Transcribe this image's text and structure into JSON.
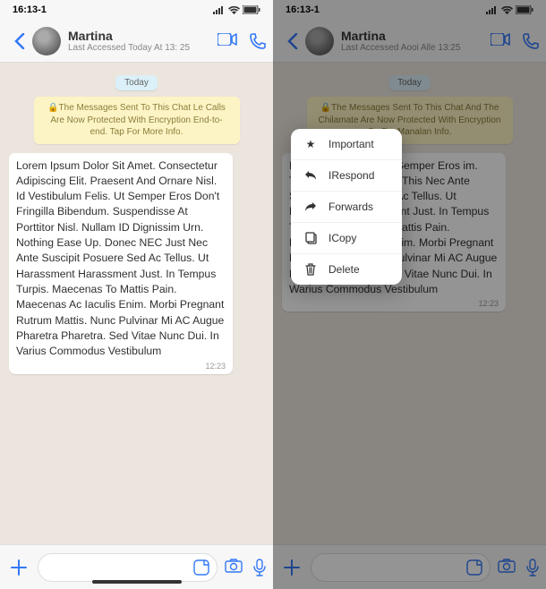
{
  "status": {
    "time": "16:13-1"
  },
  "header": {
    "contact_name": "Martina",
    "last_seen_left": "Last Accessed Today At 13: 25",
    "last_seen_right": "Last Accessed Aooi Alle 13:25"
  },
  "chat": {
    "date_label": "Today",
    "encryption_left": "🔒The Messages Sent To This Chat Le Calls Are Now Protected With Encryption End-to-end. Tap For More Info.",
    "encryption_right": "🔒The Messages Sent To This Chat And The Chilamate Are Now Protected With Encryption Ce For Manalan Info.",
    "message_text_left": "Lorem Ipsum Dolor Sit Amet. Consectetur Adipiscing Elit. Praesent And Ornare Nisl. Id Vestibulum Felis. Ut Semper Eros Don't Fringilla Bibendum. Suspendisse At Porttitor Nisl. Nullam ID Dignissim Urn. Nothing Ease Up. Donec NEC Just Nec Ante Suscipit Posuere Sed Ac Tellus. Ut Harassment Harassment Just. In Tempus Turpis. Maecenas To Mattis Pain. Maecenas Ac Iaculis Enim. Morbi Pregnant Rutrum Mattis. Nunc Pulvinar Mi AC Augue Pharetra Pharetra. Sed Vitae Nunc Dui. In Varius Commodus Vestibulum",
    "message_text_right": "It Amet. ing Elit. isl, Id Semper Eros im. Titor Nisl. Urn. Nothing This Nec Ante Suscipit Pusuere Sed Ac Tellus. Ut Harassment Harassment Just. In Tempus Turpis. Maecenas To Mattis Pain. Maecenas Aciaculis Enim. Morbi Pregnant Rutrum Mattis. Nunc Pulvinar Mi AC Augue Pharetra Pharetra. Sed Vitae Nunc Dui. In Warius Commodus Vestibulum",
    "message_time": "12:23"
  },
  "context_menu": {
    "items": [
      {
        "label": "Important"
      },
      {
        "label": "IRespond"
      },
      {
        "label": "Forwards"
      },
      {
        "label": "ICopy"
      },
      {
        "label": "Delete"
      }
    ]
  }
}
